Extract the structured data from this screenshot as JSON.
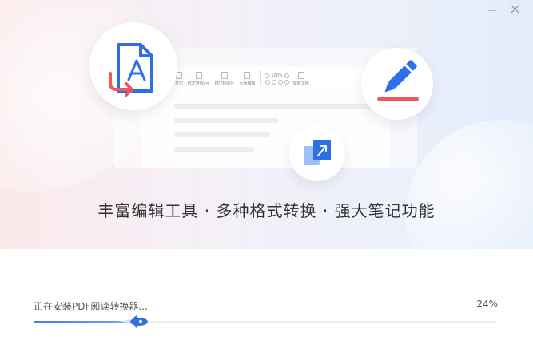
{
  "window": {
    "minimize_icon": "minimize-icon",
    "close_icon": "close-icon"
  },
  "hero": {
    "tagline": "丰富编辑工具 · 多种格式转换 · 强大笔记功能",
    "toolbar": {
      "items": [
        "打印",
        "PDF转Word",
        "PDF转图片",
        "页面编辑"
      ],
      "zoom": "100%",
      "rotate_label": "旋转文档"
    },
    "icons": [
      "pdf-convert-icon",
      "pen-icon",
      "convert-icon"
    ]
  },
  "install": {
    "status_text": "正在安装PDF阅读转换器...",
    "percent_label": "24%",
    "progress": 0.24
  },
  "colors": {
    "accent": "#3b7df7",
    "pdf_blue": "#2f6fe6",
    "pen_red": "#f0565e"
  }
}
